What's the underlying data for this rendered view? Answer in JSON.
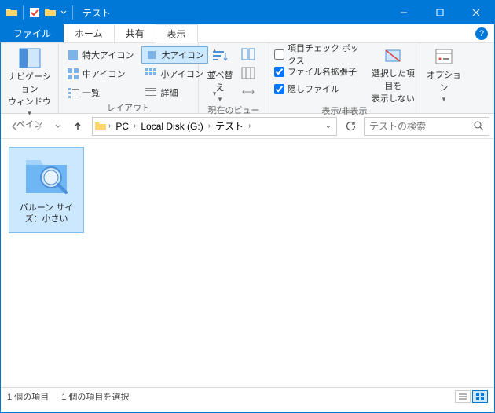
{
  "titlebar": {
    "title": "テスト"
  },
  "tabs": {
    "file": "ファイル",
    "home": "ホーム",
    "share": "共有",
    "view": "表示"
  },
  "ribbon": {
    "pane": {
      "nav": "ナビゲーション\nウィンドウ",
      "label": "ペイン"
    },
    "layout": {
      "xl": "特大アイコン",
      "l": "大アイコン",
      "m": "中アイコン",
      "s": "小アイコン",
      "list": "一覧",
      "detail": "詳細",
      "label": "レイアウト"
    },
    "current": {
      "sort": "並べ替え",
      "label": "現在のビュー"
    },
    "showhide": {
      "chk1": "項目チェック ボックス",
      "chk2": "ファイル名拡張子",
      "chk3": "隠しファイル",
      "hide_sel": "選択した項目を\n表示しない",
      "label": "表示/非表示"
    },
    "options": {
      "btn": "オプション"
    }
  },
  "breadcrumb": {
    "pc": "PC",
    "disk": "Local Disk (G:)",
    "folder": "テスト"
  },
  "search": {
    "placeholder": "テストの検索"
  },
  "item": {
    "name": "バルーン サイズ：小さい"
  },
  "status": {
    "count": "1 個の項目",
    "selected": "1 個の項目を選択"
  }
}
